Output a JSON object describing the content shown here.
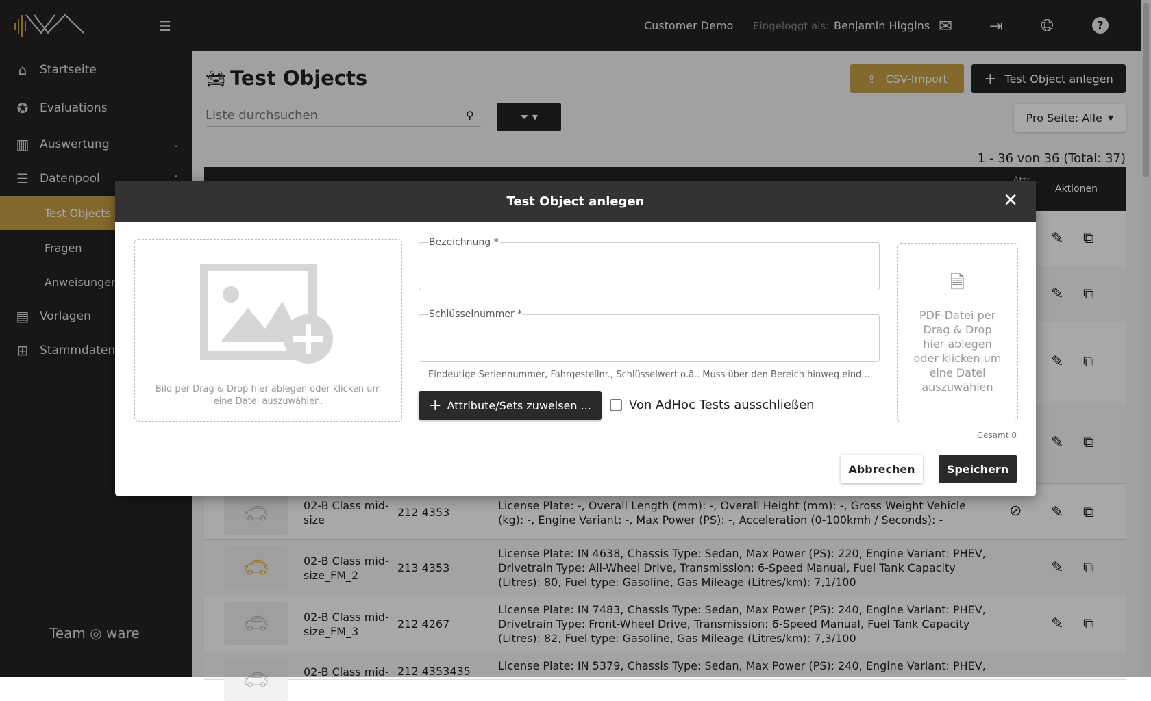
{
  "topbar": {
    "customer": "Customer Demo",
    "logged_in_label": "Eingeloggt als:",
    "user": "Benjamin Higgins",
    "icons": [
      "mail-icon",
      "logout-icon",
      "globe-icon",
      "help-icon"
    ]
  },
  "sidebar": {
    "items": [
      {
        "label": "Startseite",
        "icon": "home-icon"
      },
      {
        "label": "Evaluations",
        "icon": "star-icon"
      },
      {
        "label": "Auswertung",
        "icon": "chart-icon"
      },
      {
        "label": "Datenpool",
        "icon": "database-icon"
      },
      {
        "label": "Vorlagen",
        "icon": "template-icon"
      },
      {
        "label": "Stammdaten",
        "icon": "hierarchy-icon"
      }
    ],
    "subitems": [
      "Test Objects",
      "Fragen",
      "Anweisungen"
    ],
    "footer_logo": "Team ware SOLUTIONS"
  },
  "page": {
    "title": "Test Objects",
    "csv_import": "CSV-Import",
    "create": "Test Object anlegen",
    "search_placeholder": "Liste durchsuchen",
    "per_page": "Pro Seite: Alle",
    "count": "1 - 36 von 36 (Total: 37)",
    "col_actions": "Aktionen",
    "col_partial": "Attr..."
  },
  "rows": [
    {
      "name": "02-B Class mid-size",
      "number": "212 4353",
      "desc": "License Plate: -, Overall Length (mm): -, Overall Height (mm): -, Gross Weight Vehicle (kg): -, Engine Variant: -, Max Power (PS): -, Acceleration (0-100kmh / Seconds): -",
      "color": "#c8c8c8"
    },
    {
      "name": "02-B Class mid-size_FM_2",
      "number": "213 4353",
      "desc": "License Plate: IN 4638, Chassis Type: Sedan, Max Power (PS): 220, Engine Variant: PHEV, Drivetrain Type: All-Wheel Drive, Transmission: 6-Speed Manual, Fuel Tank Capacity (Litres): 80, Fuel type: Gasoline, Gas Mileage (Litres/km): 7,1/100",
      "color": "#e8b030"
    },
    {
      "name": "02-B Class mid-size_FM_3",
      "number": "212 4267",
      "desc": "License Plate: IN 7483, Chassis Type: Sedan, Max Power (PS): 240, Engine Variant: PHEV, Drivetrain Type: Front-Wheel Drive, Transmission: 6-Speed Manual, Fuel Tank Capacity (Litres): 82, Fuel type: Gasoline, Gas Mileage (Litres/km): 7,3/100",
      "color": "#c8c8c8"
    },
    {
      "name": "02-B Class mid-",
      "number": "212 4353435",
      "desc": "License Plate: IN 5379, Chassis Type: Sedan, Max Power (PS): 240, Engine Variant: PHEV,",
      "color": "#c8c8c8"
    }
  ],
  "modal": {
    "title": "Test Object anlegen",
    "image_drop": "Bild per Drag & Drop hier ablegen oder klicken um eine Datei auszuwählen.",
    "field1_label": "Bezeichnung *",
    "field1_value": "",
    "field2_label": "Schlüsselnummer *",
    "field2_value": "",
    "hint": "Eindeutige Seriennummer, Fahrgestellnr., Schlüsselwert o.ä.. Muss über den Bereich hinweg eind...",
    "assign_button": "Attribute/Sets zuweisen ...",
    "exclude_adhoc": "Von AdHoc Tests ausschließen",
    "exclude_checked": false,
    "pdf_drop": "PDF-Datei per Drag & Drop hier ablegen oder klicken um eine Datei auszuwählen",
    "total": "Gesamt 0",
    "cancel": "Abbrechen",
    "save": "Speichern"
  },
  "colors": {
    "accent": "#c9a046",
    "dark": "#232323"
  }
}
